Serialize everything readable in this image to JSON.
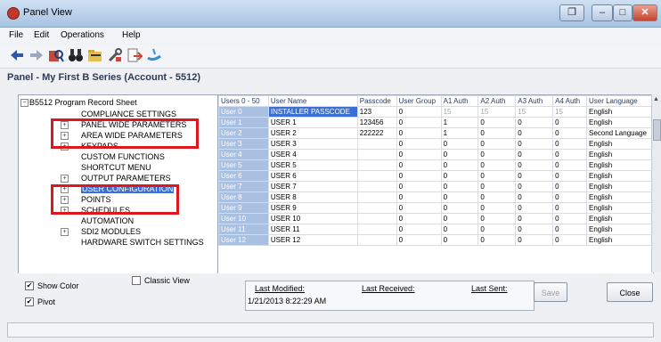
{
  "window": {
    "title": "Panel View"
  },
  "menu": [
    "File",
    "Edit",
    "Operations",
    "Help"
  ],
  "toolbar_icons": [
    "back-arrow-icon",
    "forward-arrow-icon",
    "panel-search-icon",
    "binoculars-icon",
    "folder-icon",
    "tools-icon",
    "document-arrow-icon",
    "checkmark-icon"
  ],
  "panel_title": "Panel - My First B Series (Account - 5512)",
  "tree": {
    "root": "B5512 Program Record Sheet",
    "nodes": [
      {
        "label": "COMPLIANCE SETTINGS",
        "expandable": false
      },
      {
        "label": "PANEL WIDE PARAMETERS",
        "expandable": true
      },
      {
        "label": "AREA WIDE PARAMETERS",
        "expandable": true
      },
      {
        "label": "KEYPADS",
        "expandable": true
      },
      {
        "label": "CUSTOM FUNCTIONS",
        "expandable": false
      },
      {
        "label": "SHORTCUT MENU",
        "expandable": false
      },
      {
        "label": "OUTPUT PARAMETERS",
        "expandable": true
      },
      {
        "label": "USER CONFIGURATION",
        "expandable": true,
        "selected": true
      },
      {
        "label": "POINTS",
        "expandable": true
      },
      {
        "label": "SCHEDULES",
        "expandable": true
      },
      {
        "label": "AUTOMATION",
        "expandable": false
      },
      {
        "label": "SDI2 MODULES",
        "expandable": true
      },
      {
        "label": "HARDWARE SWITCH SETTINGS",
        "expandable": false
      }
    ]
  },
  "table": {
    "columns": [
      "Users 0 - 50",
      "User Name",
      "Passcode",
      "User Group",
      "A1 Auth",
      "A2 Auth",
      "A3 Auth",
      "A4 Auth",
      "User Language"
    ],
    "rows": [
      [
        "User 0",
        "INSTALLER PASSCODE",
        "123",
        "0",
        "15",
        "15",
        "15",
        "15",
        "English"
      ],
      [
        "User 1",
        "USER 1",
        "123456",
        "0",
        "1",
        "0",
        "0",
        "0",
        "English"
      ],
      [
        "User 2",
        "USER 2",
        "222222",
        "0",
        "1",
        "0",
        "0",
        "0",
        "Second Language"
      ],
      [
        "User 3",
        "USER 3",
        "",
        "0",
        "0",
        "0",
        "0",
        "0",
        "English"
      ],
      [
        "User 4",
        "USER 4",
        "",
        "0",
        "0",
        "0",
        "0",
        "0",
        "English"
      ],
      [
        "User 5",
        "USER 5",
        "",
        "0",
        "0",
        "0",
        "0",
        "0",
        "English"
      ],
      [
        "User 6",
        "USER 6",
        "",
        "0",
        "0",
        "0",
        "0",
        "0",
        "English"
      ],
      [
        "User 7",
        "USER 7",
        "",
        "0",
        "0",
        "0",
        "0",
        "0",
        "English"
      ],
      [
        "User 8",
        "USER 8",
        "",
        "0",
        "0",
        "0",
        "0",
        "0",
        "English"
      ],
      [
        "User 9",
        "USER 9",
        "",
        "0",
        "0",
        "0",
        "0",
        "0",
        "English"
      ],
      [
        "User 10",
        "USER 10",
        "",
        "0",
        "0",
        "0",
        "0",
        "0",
        "English"
      ],
      [
        "User 11",
        "USER 11",
        "",
        "0",
        "0",
        "0",
        "0",
        "0",
        "English"
      ],
      [
        "User 12",
        "USER 12",
        "",
        "0",
        "0",
        "0",
        "0",
        "0",
        "English"
      ]
    ]
  },
  "options": {
    "show_color": "Show Color",
    "classic_view": "Classic View",
    "pivot": "Pivot"
  },
  "dates": {
    "last_modified_label": "Last Modified:",
    "last_received_label": "Last Received:",
    "last_sent_label": "Last Sent:",
    "last_modified_value": "1/21/2013 8:22:29 AM"
  },
  "buttons": {
    "save": "Save",
    "close": "Close"
  },
  "colors": {
    "selection": "#3b6fd6",
    "callout": "#e0161e",
    "row_header": "#a9c0e0"
  }
}
